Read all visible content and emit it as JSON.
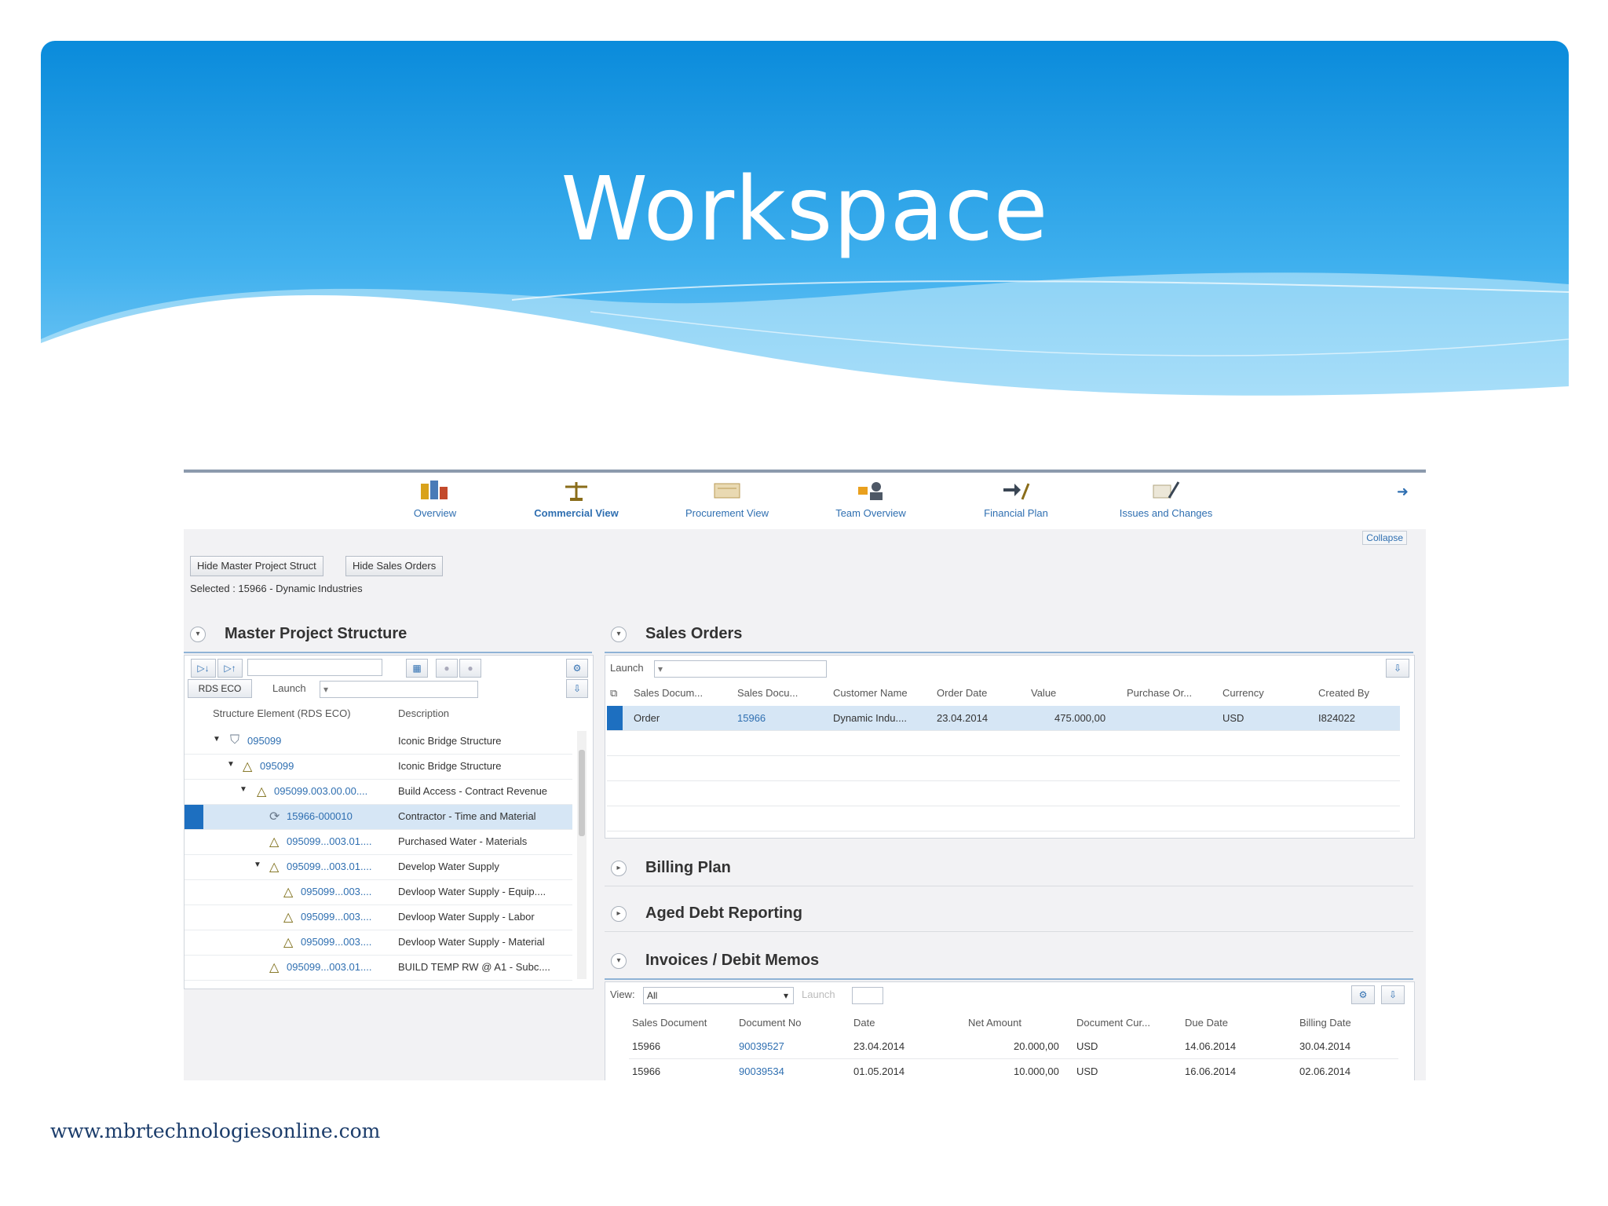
{
  "slide": {
    "title": "Workspace",
    "footer_url": "www.mbrtechnologiesonline.com",
    "colors": {
      "banner_top": "#0e8fdc",
      "banner_bottom": "#64c3f4",
      "wave": "#9fd8f8"
    }
  },
  "app": {
    "nav": [
      {
        "label": "Overview",
        "icon": "overview-icon"
      },
      {
        "label": "Commercial View",
        "icon": "scale-icon"
      },
      {
        "label": "Procurement View",
        "icon": "procurement-icon"
      },
      {
        "label": "Team Overview",
        "icon": "team-icon"
      },
      {
        "label": "Financial Plan",
        "icon": "financial-plan-icon"
      },
      {
        "label": "Issues and Changes",
        "icon": "issues-icon"
      }
    ],
    "active_nav": "Commercial View",
    "collapse_label": "Collapse",
    "buttons": {
      "hide_master": "Hide Master Project Struct",
      "hide_sales": "Hide Sales Orders"
    },
    "selected_text": "Selected : 15966 - Dynamic Industries",
    "master_structure": {
      "title": "Master Project Structure",
      "filter_button": "RDS ECO",
      "launch_label": "Launch",
      "col_element": "Structure Element (RDS ECO)",
      "col_desc": "Description",
      "rows": [
        {
          "elem": "095099",
          "desc": "Iconic Bridge Structure"
        },
        {
          "elem": "095099",
          "desc": "Iconic Bridge Structure"
        },
        {
          "elem": "095099.003.00.00....",
          "desc": "Build Access - Contract Revenue"
        },
        {
          "elem": "15966-000010",
          "desc": "Contractor - Time and Material"
        },
        {
          "elem": "095099...003.01....",
          "desc": "Purchased Water - Materials"
        },
        {
          "elem": "095099...003.01....",
          "desc": "Develop Water Supply"
        },
        {
          "elem": "095099...003....",
          "desc": "Devloop Water Supply - Equip...."
        },
        {
          "elem": "095099...003....",
          "desc": "Devloop Water Supply - Labor"
        },
        {
          "elem": "095099...003....",
          "desc": "Devloop Water Supply - Material"
        },
        {
          "elem": "095099...003.01....",
          "desc": "BUILD TEMP RW @ A1 - Subc...."
        }
      ]
    },
    "sales_orders": {
      "title": "Sales Orders",
      "launch_label": "Launch",
      "columns": [
        "Sales Docum...",
        "Sales Docu...",
        "Customer Name",
        "Order Date",
        "Value",
        "Purchase Or...",
        "Currency",
        "Created By"
      ],
      "rows": [
        {
          "type": "Order",
          "doc": "15966",
          "customer": "Dynamic Indu....",
          "date": "23.04.2014",
          "value": "475.000,00",
          "po": "",
          "currency": "USD",
          "created_by": "I824022"
        }
      ]
    },
    "billing_plan": {
      "title": "Billing Plan"
    },
    "aged_debt": {
      "title": "Aged Debt Reporting"
    },
    "invoices": {
      "title": "Invoices / Debit Memos",
      "view_label": "View:",
      "view_value": "All",
      "launch_label": "Launch",
      "columns": [
        "Sales Document",
        "Document No",
        "Date",
        "Net Amount",
        "Document Cur...",
        "Due Date",
        "Billing Date"
      ],
      "rows": [
        {
          "sales_doc": "15966",
          "doc_no": "90039527",
          "date": "23.04.2014",
          "net": "20.000,00",
          "cur": "USD",
          "due": "14.06.2014",
          "billing": "30.04.2014"
        },
        {
          "sales_doc": "15966",
          "doc_no": "90039534",
          "date": "01.05.2014",
          "net": "10.000,00",
          "cur": "USD",
          "due": "16.06.2014",
          "billing": "02.06.2014"
        }
      ]
    }
  }
}
